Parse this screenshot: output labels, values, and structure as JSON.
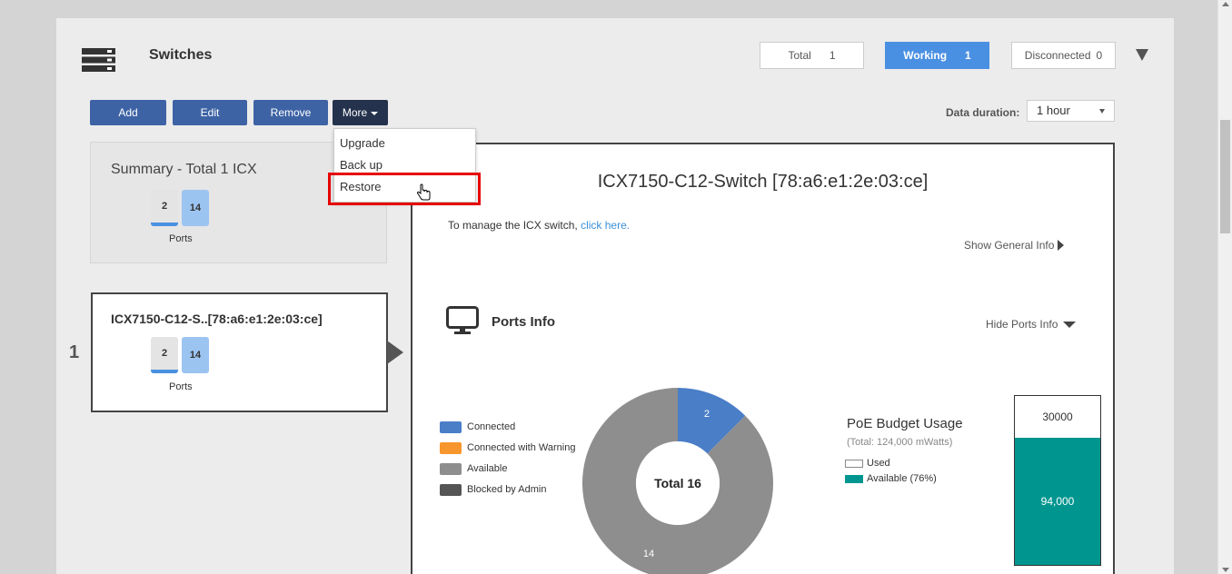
{
  "header": {
    "title": "Switches",
    "stats": {
      "total_label": "Total",
      "total_value": "1",
      "working_label": "Working",
      "working_value": "1",
      "disconnected_label": "Disconnected",
      "disconnected_value": "0"
    }
  },
  "toolbar": {
    "add": "Add",
    "edit": "Edit",
    "remove": "Remove",
    "more": "More",
    "duration_label": "Data duration:",
    "duration_value": "1 hour"
  },
  "more_menu": {
    "items": [
      "Upgrade",
      "Back up",
      "Restore"
    ],
    "hovered": "Restore"
  },
  "summary": {
    "title": "Summary - Total 1 ICX",
    "used_ports": "2",
    "available_ports": "14",
    "ports_label": "Ports"
  },
  "device_list": [
    {
      "index": "1",
      "name": "ICX7150-C12-S..[78:a6:e1:2e:03:ce]",
      "used_ports": "2",
      "available_ports": "14",
      "ports_label": "Ports"
    }
  ],
  "detail": {
    "title": "ICX7150-C12-Switch [78:a6:e1:2e:03:ce]",
    "manage_text": "To manage the ICX switch,",
    "manage_link": "click here.",
    "show_general": "Show General Info",
    "ports_title": "Ports Info",
    "hide_ports": "Hide Ports Info"
  },
  "chart_data": [
    {
      "type": "pie",
      "title": "",
      "center_label": "Total 16",
      "legend": [
        "Connected",
        "Connected with Warning",
        "Available",
        "Blocked by Admin"
      ],
      "slices": [
        {
          "name": "Connected",
          "value": 2,
          "color": "#4a7ec7"
        },
        {
          "name": "Connected with Warning",
          "value": 0,
          "color": "#f7962d"
        },
        {
          "name": "Available",
          "value": 14,
          "color": "#8e8e8e"
        },
        {
          "name": "Blocked by Admin",
          "value": 0,
          "color": "#555555"
        }
      ]
    },
    {
      "type": "bar",
      "title": "PoE Budget Usage",
      "subtitle": "(Total: 124,000 mWatts)",
      "legend": [
        "Used",
        "Available (76%)"
      ],
      "series": [
        {
          "name": "Used",
          "value": 30000,
          "label": "30000",
          "color": "#ffffff"
        },
        {
          "name": "Available",
          "value": 94000,
          "label": "94,000",
          "color": "#00968f"
        }
      ]
    }
  ],
  "colors": {
    "primary_button": "#3e63a5",
    "more_button": "#24324d",
    "working": "#4a90e2",
    "highlight": "#e60000"
  }
}
